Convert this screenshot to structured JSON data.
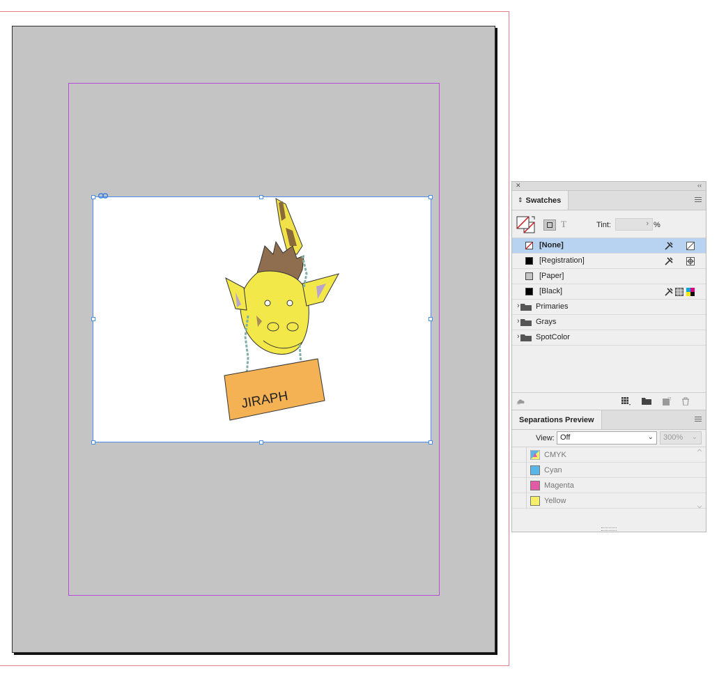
{
  "document": {
    "art": {
      "sign_text": "JIRAPH"
    }
  },
  "swatches_panel": {
    "tab_label": "Swatches",
    "tint_label": "Tint:",
    "tint_value": "",
    "tint_unit": "%",
    "text_format_glyph": "T",
    "swatches": [
      {
        "name": "[None]",
        "selected": true
      },
      {
        "name": "[Registration]",
        "selected": false
      },
      {
        "name": "[Paper]",
        "selected": false
      },
      {
        "name": "[Black]",
        "selected": false
      }
    ],
    "groups": [
      "Primaries",
      "Grays",
      "SpotColor"
    ]
  },
  "separations_panel": {
    "tab_label": "Separations Preview",
    "view_label": "View:",
    "view_value": "Off",
    "zoom_value": "300%",
    "plates": [
      {
        "name": "CMYK",
        "color": "#cccccc"
      },
      {
        "name": "Cyan",
        "color": "#5ab6e6"
      },
      {
        "name": "Magenta",
        "color": "#e05aa6"
      },
      {
        "name": "Yellow",
        "color": "#f7ef6a"
      }
    ]
  }
}
